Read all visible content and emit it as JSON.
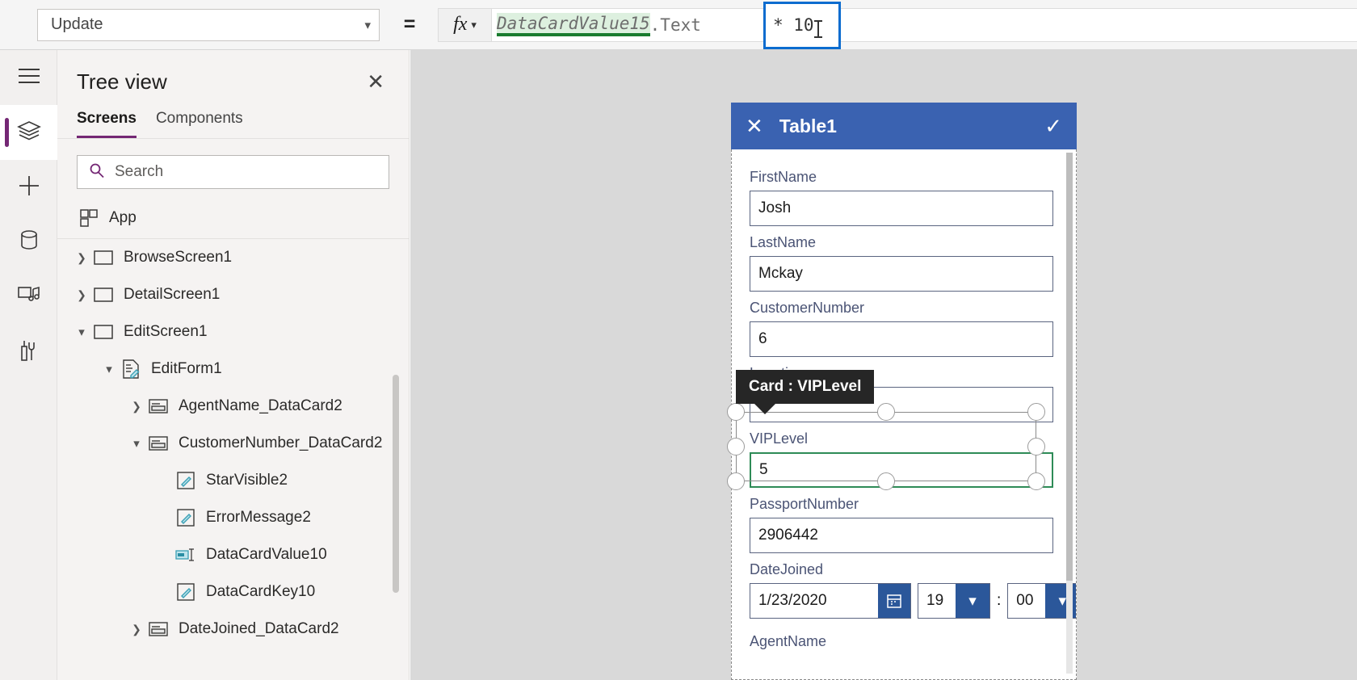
{
  "formula_bar": {
    "property": "Update",
    "equals": "=",
    "fx_label": "fx",
    "chevron": "⌄",
    "formula_identifier": "DataCardValue15",
    "formula_property": ".Text",
    "formula_selection": "* 10"
  },
  "rail": {
    "items": [
      {
        "name": "hamburger-menu",
        "label": "Menu"
      },
      {
        "name": "tree-view",
        "label": "Tree view"
      },
      {
        "name": "insert",
        "label": "Insert"
      },
      {
        "name": "data",
        "label": "Data"
      },
      {
        "name": "media",
        "label": "Media"
      },
      {
        "name": "advanced-tools",
        "label": "Advanced tools"
      }
    ]
  },
  "tree_panel": {
    "title": "Tree view",
    "close": "✕",
    "tabs": [
      {
        "label": "Screens",
        "active": true
      },
      {
        "label": "Components",
        "active": false
      }
    ],
    "search_placeholder": "Search",
    "app_item": "App",
    "items": [
      {
        "label": "BrowseScreen1",
        "indent": 0,
        "chevron": "›",
        "icon": "screen-icon"
      },
      {
        "label": "DetailScreen1",
        "indent": 0,
        "chevron": "›",
        "icon": "screen-icon"
      },
      {
        "label": "EditScreen1",
        "indent": 0,
        "chevron": "⌄",
        "icon": "screen-icon"
      },
      {
        "label": "EditForm1",
        "indent": 1,
        "chevron": "⌄",
        "icon": "form-icon"
      },
      {
        "label": "AgentName_DataCard2",
        "indent": 2,
        "chevron": "›",
        "icon": "datacard-icon"
      },
      {
        "label": "CustomerNumber_DataCard2",
        "indent": 2,
        "chevron": "⌄",
        "icon": "datacard-icon"
      },
      {
        "label": "StarVisible2",
        "indent": 3,
        "chevron": "",
        "icon": "label-icon"
      },
      {
        "label": "ErrorMessage2",
        "indent": 3,
        "chevron": "",
        "icon": "label-icon"
      },
      {
        "label": "DataCardValue10",
        "indent": 3,
        "chevron": "",
        "icon": "textinput-icon"
      },
      {
        "label": "DataCardKey10",
        "indent": 3,
        "chevron": "",
        "icon": "label-icon"
      },
      {
        "label": "DateJoined_DataCard2",
        "indent": 2,
        "chevron": "›",
        "icon": "datacard-icon"
      }
    ]
  },
  "canvas": {
    "form": {
      "header_title": "Table1",
      "header_close": "✕",
      "header_check": "✓",
      "tooltip": "Card : VIPLevel",
      "fields": [
        {
          "label": "FirstName",
          "value": "Josh"
        },
        {
          "label": "LastName",
          "value": "Mckay"
        },
        {
          "label": "CustomerNumber",
          "value": "6"
        },
        {
          "label": "Location",
          "value": ""
        },
        {
          "label": "VIPLevel",
          "value": "5",
          "selected": true
        },
        {
          "label": "PassportNumber",
          "value": "2906442"
        }
      ],
      "date_field": {
        "label": "DateJoined",
        "date_value": "1/23/2020",
        "hour_value": "19",
        "separator": ":",
        "minute_value": "00",
        "dropdown_chevron": "⌄"
      },
      "partial_label": "AgentName"
    }
  },
  "colors": {
    "accent_purple": "#742774",
    "form_header_blue": "#3a62b1",
    "selection_blue": "#0b6ccf",
    "selected_green": "#2e8b57",
    "button_blue": "#2b579a"
  }
}
